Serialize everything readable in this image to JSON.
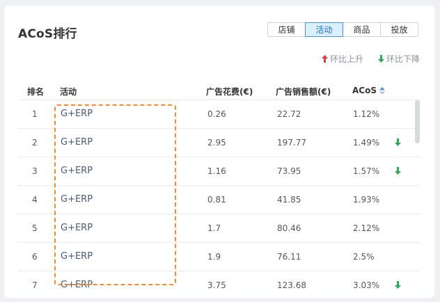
{
  "title": "ACoS排行",
  "tabs": [
    {
      "label": "店铺",
      "active": false
    },
    {
      "label": "活动",
      "active": true
    },
    {
      "label": "商品",
      "active": false
    },
    {
      "label": "投放",
      "active": false
    }
  ],
  "legend": {
    "up": "环比上升",
    "down": "环比下降",
    "up_color": "#e23b3b",
    "down_color": "#33a852"
  },
  "columns": {
    "rank": "排名",
    "activity": "活动",
    "ad_spend": "广告花费(€)",
    "ad_sales": "广告销售额(€)",
    "acos": "ACoS"
  },
  "rows": [
    {
      "rank": "1",
      "activity": "G+ERP",
      "ad_spend": "0.26",
      "ad_sales": "22.72",
      "acos": "1.12%",
      "trend": "none"
    },
    {
      "rank": "2",
      "activity": "G+ERP",
      "ad_spend": "2.95",
      "ad_sales": "197.77",
      "acos": "1.49%",
      "trend": "down"
    },
    {
      "rank": "3",
      "activity": "G+ERP",
      "ad_spend": "1.16",
      "ad_sales": "73.95",
      "acos": "1.57%",
      "trend": "down"
    },
    {
      "rank": "4",
      "activity": "G+ERP",
      "ad_spend": "0.81",
      "ad_sales": "41.85",
      "acos": "1.93%",
      "trend": "none"
    },
    {
      "rank": "5",
      "activity": "G+ERP",
      "ad_spend": "1.7",
      "ad_sales": "80.46",
      "acos": "2.12%",
      "trend": "none"
    },
    {
      "rank": "6",
      "activity": "G+ERP",
      "ad_spend": "1.9",
      "ad_sales": "76.11",
      "acos": "2.5%",
      "trend": "none"
    },
    {
      "rank": "7",
      "activity": "G+ERP",
      "ad_spend": "3.75",
      "ad_sales": "123.68",
      "acos": "3.03%",
      "trend": "down"
    }
  ]
}
